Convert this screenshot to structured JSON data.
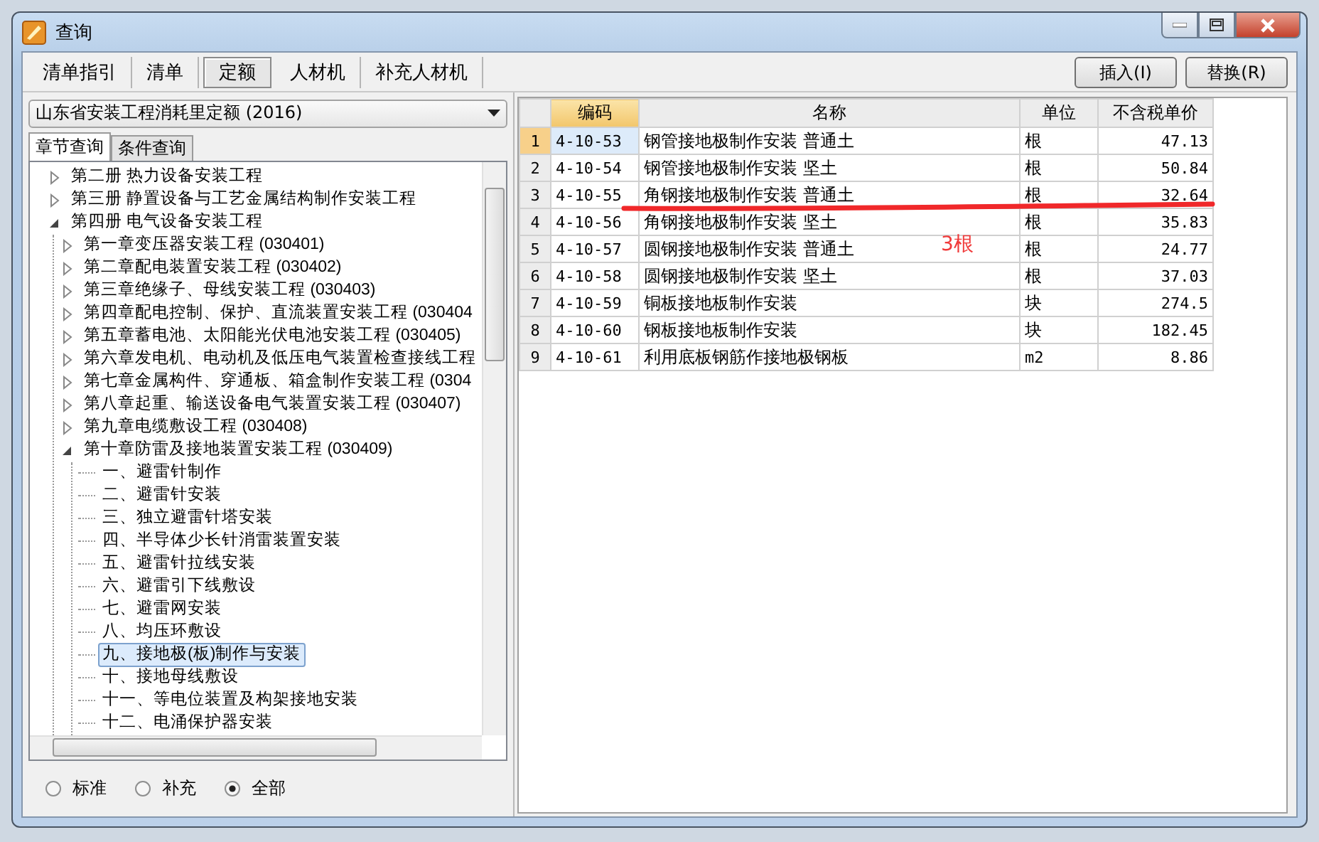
{
  "window": {
    "title": "查询"
  },
  "tabs": [
    {
      "label": "清单指引",
      "selected": false
    },
    {
      "label": "清单",
      "selected": false
    },
    {
      "label": "定额",
      "selected": true
    },
    {
      "label": "人材机",
      "selected": false
    },
    {
      "label": "补充人材机",
      "selected": false
    }
  ],
  "library_dropdown": {
    "value": "山东省安装工程消耗里定额 (2016)"
  },
  "query_tabs": [
    {
      "label": "章节查询",
      "selected": true
    },
    {
      "label": "条件查询",
      "selected": false
    }
  ],
  "tree": [
    {
      "label": "第二册  热力设备安装工程",
      "expanded": false,
      "selected": false
    },
    {
      "label": "第三册  静置设备与工艺金属结构制作安装工程",
      "expanded": false,
      "selected": false
    },
    {
      "label": "第四册  电气设备安装工程",
      "expanded": true,
      "selected": false,
      "children": [
        {
          "label": "第一章变压器安装工程 (030401)",
          "expanded": false,
          "selected": false
        },
        {
          "label": "第二章配电装置安装工程 (030402)",
          "expanded": false,
          "selected": false
        },
        {
          "label": "第三章绝缘子、母线安装工程 (030403)",
          "expanded": false,
          "selected": false
        },
        {
          "label": "第四章配电控制、保护、直流装置安装工程 (030404",
          "expanded": false,
          "selected": false
        },
        {
          "label": "第五章蓄电池、太阳能光伏电池安装工程 (030405)",
          "expanded": false,
          "selected": false
        },
        {
          "label": "第六章发电机、电动机及低压电气装置检查接线工程",
          "expanded": false,
          "selected": false
        },
        {
          "label": "第七章金属构件、穿通板、箱盒制作安装工程 (0304",
          "expanded": false,
          "selected": false
        },
        {
          "label": "第八章起重、输送设备电气装置安装工程 (030407)",
          "expanded": false,
          "selected": false
        },
        {
          "label": "第九章电缆敷设工程 (030408)",
          "expanded": false,
          "selected": false
        },
        {
          "label": "第十章防雷及接地装置安装工程 (030409)",
          "expanded": true,
          "selected": false,
          "children": [
            {
              "label": "一、避雷针制作",
              "selected": false
            },
            {
              "label": "二、避雷针安装",
              "selected": false
            },
            {
              "label": "三、独立避雷针塔安装",
              "selected": false
            },
            {
              "label": "四、半导体少长针消雷装置安装",
              "selected": false
            },
            {
              "label": "五、避雷针拉线安装",
              "selected": false
            },
            {
              "label": "六、避雷引下线敷设",
              "selected": false
            },
            {
              "label": "七、避雷网安装",
              "selected": false
            },
            {
              "label": "八、均压环敷设",
              "selected": false
            },
            {
              "label": "九、接地极(板)制作与安装",
              "selected": true
            },
            {
              "label": "十、接地母线敷设",
              "selected": false
            },
            {
              "label": "十一、等电位装置及构架接地安装",
              "selected": false
            },
            {
              "label": "十二、电涌保护器安装",
              "selected": false
            }
          ]
        }
      ]
    }
  ],
  "filter_options": [
    {
      "label": "标准",
      "selected": false
    },
    {
      "label": "补充",
      "selected": false
    },
    {
      "label": "全部",
      "selected": true
    }
  ],
  "buttons": [
    "插入(I)",
    "替换(R)"
  ],
  "table": {
    "columns": [
      {
        "label": "编码",
        "selected": true
      },
      {
        "label": "名称",
        "selected": false
      },
      {
        "label": "单位",
        "selected": false
      },
      {
        "label": "不含税单价",
        "selected": false
      }
    ],
    "rows": [
      {
        "number": "1",
        "code": "4-10-53",
        "name": "钢管接地极制作安装 普通土",
        "unit": "根",
        "price": "47.13",
        "selected": true
      },
      {
        "number": "2",
        "code": "4-10-54",
        "name": "钢管接地极制作安装 坚土",
        "unit": "根",
        "price": "50.84",
        "selected": false
      },
      {
        "number": "3",
        "code": "4-10-55",
        "name": "角钢接地极制作安装 普通土",
        "unit": "根",
        "price": "32.64",
        "selected": false
      },
      {
        "number": "4",
        "code": "4-10-56",
        "name": "角钢接地极制作安装 坚土",
        "unit": "根",
        "price": "35.83",
        "selected": false
      },
      {
        "number": "5",
        "code": "4-10-57",
        "name": "圆钢接地极制作安装 普通土",
        "unit": "根",
        "price": "24.77",
        "selected": false
      },
      {
        "number": "6",
        "code": "4-10-58",
        "name": "圆钢接地极制作安装 坚土",
        "unit": "根",
        "price": "37.03",
        "selected": false
      },
      {
        "number": "7",
        "code": "4-10-59",
        "name": "铜板接地板制作安装",
        "unit": "块",
        "price": "274.5",
        "selected": false
      },
      {
        "number": "8",
        "code": "4-10-60",
        "name": "钢板接地板制作安装",
        "unit": "块",
        "price": "182.45",
        "selected": false
      },
      {
        "number": "9",
        "code": "4-10-61",
        "name": "利用底板钢筋作接地极钢板",
        "unit": "m2",
        "price": "8.86",
        "selected": false
      }
    ]
  },
  "annotation": {
    "text": "3根"
  }
}
